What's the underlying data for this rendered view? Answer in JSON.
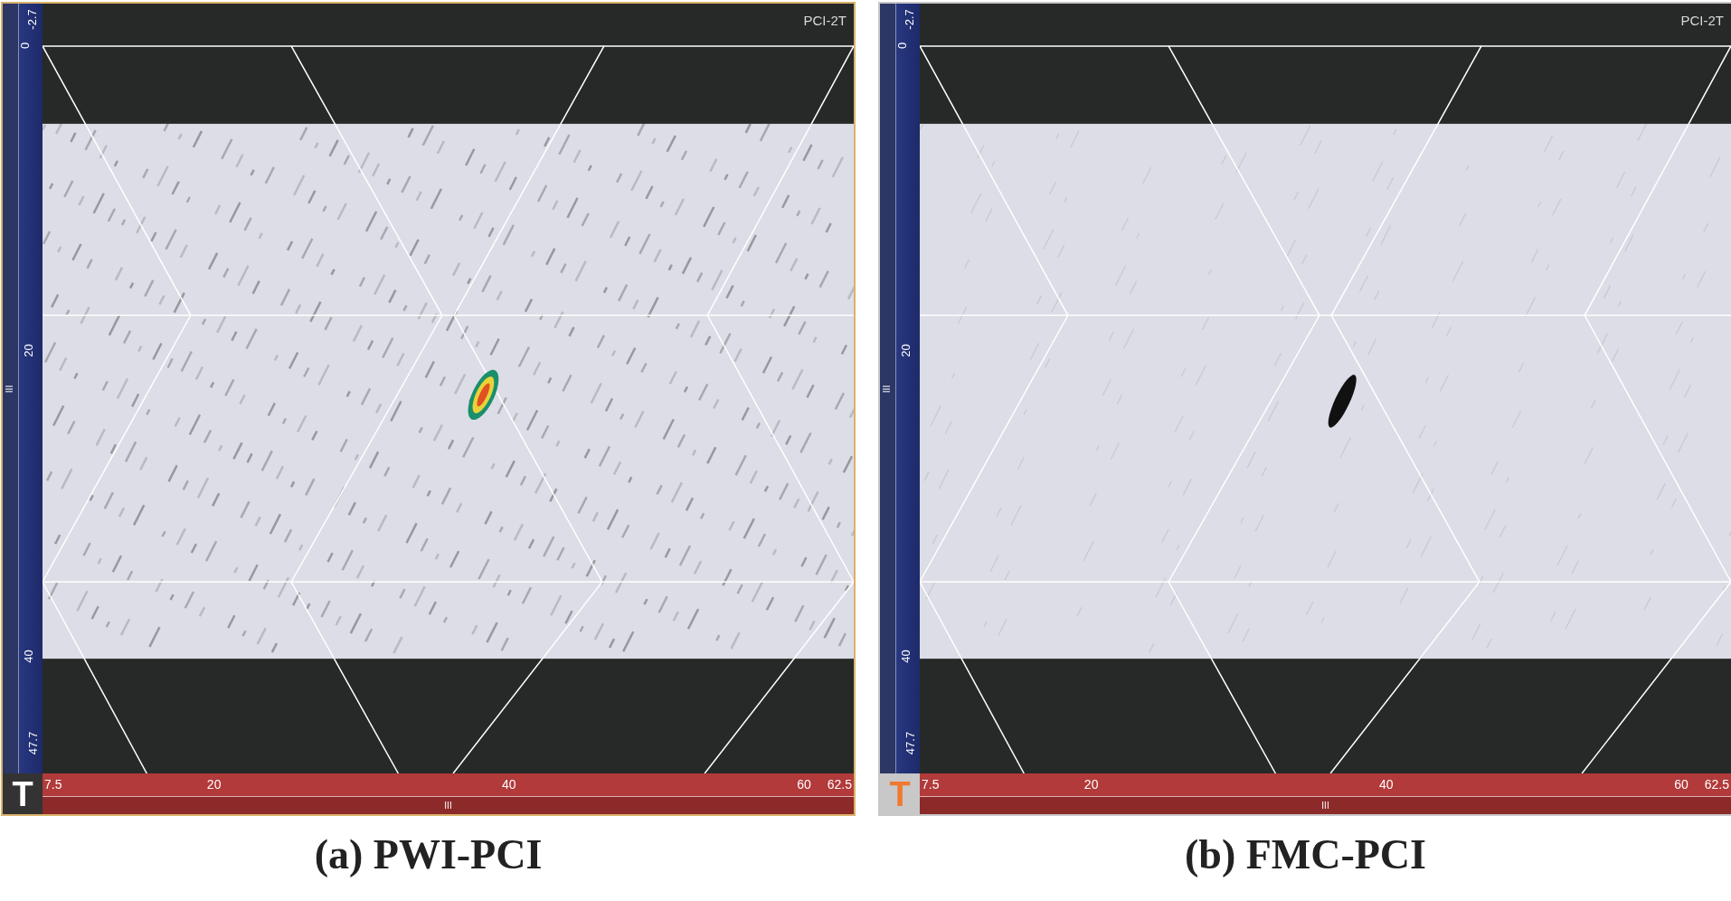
{
  "panels": [
    {
      "view_label": "PCI-2T",
      "color_map": true,
      "y_axis": [
        "-2.7",
        "0",
        "20",
        "40",
        "47.7"
      ],
      "x_axis": [
        "7.5",
        "20",
        "40",
        "60",
        "62.5"
      ],
      "y_scroll": "III",
      "x_scroll": "III",
      "mode_button": {
        "label": "T",
        "selected": false
      },
      "caption": "(a) PWI-PCI"
    },
    {
      "view_label": "PCI-2T",
      "color_map": false,
      "y_axis": [
        "-2.7",
        "0",
        "20",
        "40",
        "47.7"
      ],
      "x_axis": [
        "7.5",
        "20",
        "40",
        "60",
        "62.5"
      ],
      "y_scroll": "III",
      "x_scroll": "III",
      "mode_button": {
        "label": "T",
        "selected": true
      },
      "caption": "(b) FMC-PCI"
    }
  ]
}
